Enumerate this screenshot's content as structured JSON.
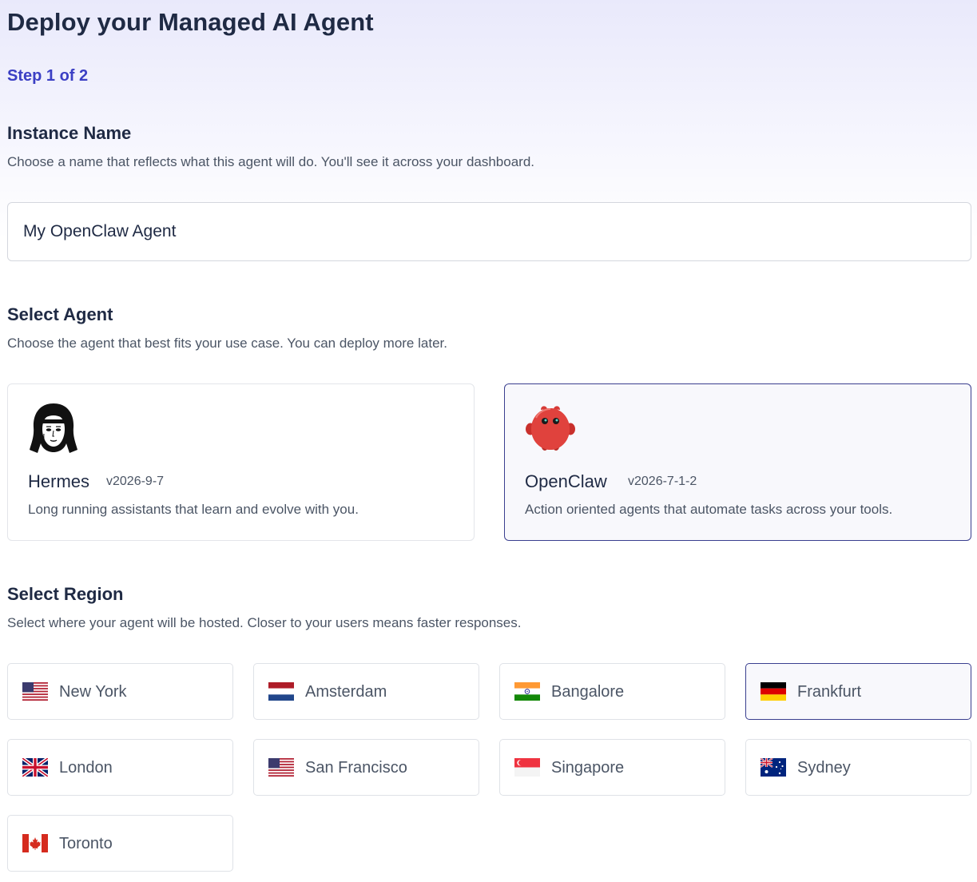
{
  "page": {
    "title": "Deploy your Managed AI Agent",
    "step": "Step 1 of 2"
  },
  "instance": {
    "title": "Instance Name",
    "description": "Choose a name that reflects what this agent will do. You'll see it across your dashboard.",
    "value": "My OpenClaw Agent"
  },
  "agents": {
    "title": "Select Agent",
    "description": "Choose the agent that best fits your use case. You can deploy more later.",
    "selected": "OpenClaw",
    "items": [
      {
        "name": "Hermes",
        "version": "v2026-9-7",
        "description": "Long running assistants that learn and evolve with you.",
        "icon": "hermes-portrait-icon"
      },
      {
        "name": "OpenClaw",
        "version": "v2026-7-1-2",
        "description": "Action oriented agents that automate tasks across your tools.",
        "icon": "openclaw-mascot-icon"
      }
    ]
  },
  "regions": {
    "title": "Select Region",
    "description": "Select where your agent will be hosted. Closer to your users means faster responses.",
    "selected": "Frankfurt",
    "items": [
      {
        "label": "New York",
        "flag": "us-flag-icon"
      },
      {
        "label": "Amsterdam",
        "flag": "nl-flag-icon"
      },
      {
        "label": "Bangalore",
        "flag": "in-flag-icon"
      },
      {
        "label": "Frankfurt",
        "flag": "de-flag-icon"
      },
      {
        "label": "London",
        "flag": "gb-flag-icon"
      },
      {
        "label": "San Francisco",
        "flag": "us-flag-icon"
      },
      {
        "label": "Singapore",
        "flag": "sg-flag-icon"
      },
      {
        "label": "Sydney",
        "flag": "au-flag-icon"
      },
      {
        "label": "Toronto",
        "flag": "ca-flag-icon"
      }
    ]
  },
  "colors": {
    "accent": "#3b3fc4",
    "selected_border": "#3a3f8f",
    "heading": "#1f2a44",
    "muted_text": "#4b5565"
  }
}
